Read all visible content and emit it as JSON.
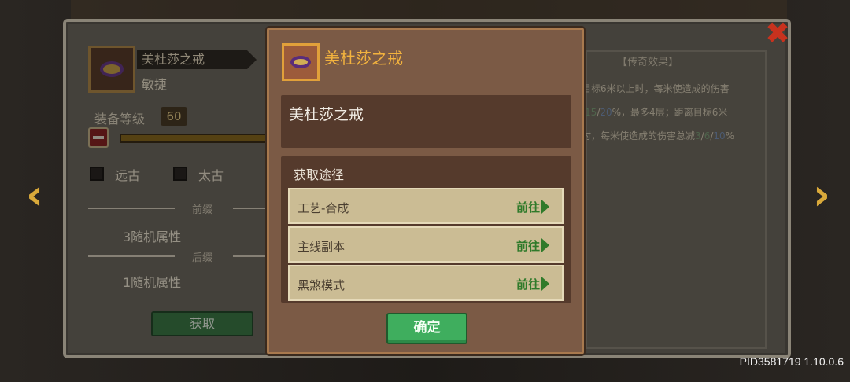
{
  "item": {
    "name": "美杜莎之戒",
    "type": "敏捷",
    "level_label": "装备等级",
    "level_value": "60"
  },
  "checks": [
    {
      "label": "远古"
    },
    {
      "label": "太古"
    }
  ],
  "prefix": {
    "label": "前缀",
    "attr": "3随机属性"
  },
  "suffix": {
    "label": "后缀",
    "attr": "1随机属性"
  },
  "get_button": "获取",
  "legend_effect": {
    "title": "【传奇效果】",
    "line1": "目标6米以上时，每米使造成的伤害",
    "line2_a": "/",
    "line2_v1": "15",
    "line2_b": "/",
    "line2_v2": "20",
    "line2_c": "%，最多4层；距离目标6米",
    "line3_a": "时，每米使造成的伤害总减",
    "line3_v0": "3",
    "line3_s1": "/",
    "line3_v1": "6",
    "line3_s2": "/",
    "line3_v2": "10",
    "line3_c": "%"
  },
  "modal": {
    "title": "美杜莎之戒",
    "description": "美杜莎之戒",
    "source_title": "获取途径",
    "sources": [
      {
        "label": "工艺-合成",
        "action": "前往"
      },
      {
        "label": "主线副本",
        "action": "前往"
      },
      {
        "label": "黑煞模式",
        "action": "前往"
      }
    ],
    "confirm": "确定"
  },
  "footer": {
    "pid": "PID3581719 1.10.0.6"
  },
  "colors": {
    "modal_bg": "#7b5a45",
    "accent_gold": "#f3b33e",
    "confirm_green": "#3fae5e"
  }
}
